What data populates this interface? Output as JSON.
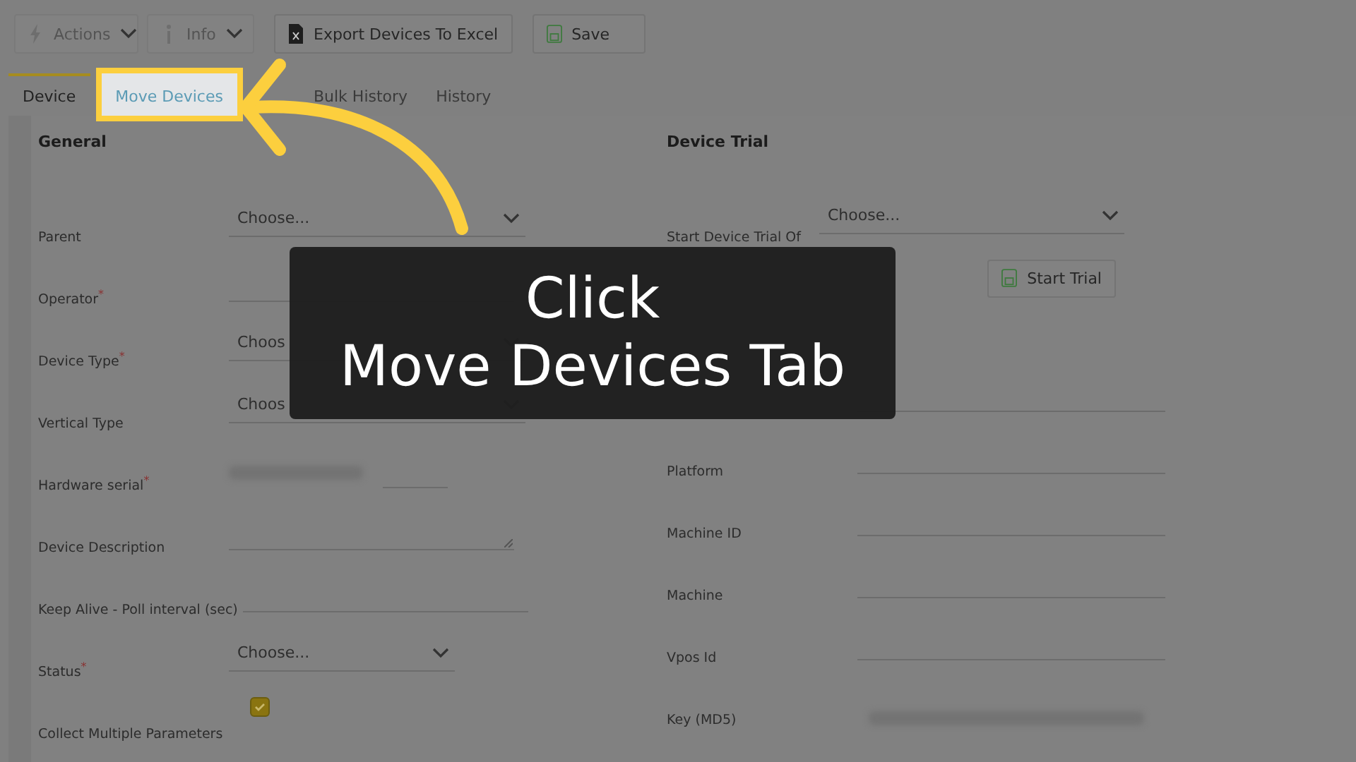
{
  "toolbar": {
    "buttons": [
      {
        "kind": "dropdown",
        "label": "Actions",
        "disabled": true
      },
      {
        "kind": "dropdown",
        "label": "Info",
        "disabled": true
      },
      {
        "kind": "plain",
        "label": "Export Devices To Excel",
        "disabled": false
      },
      {
        "kind": "plain",
        "label": "Save",
        "disabled": false
      }
    ]
  },
  "tabs": [
    {
      "label": "Device",
      "selected": true,
      "highlighted": false
    },
    {
      "label": "Move Devices",
      "selected": false,
      "highlighted": true
    },
    {
      "label": "Bulk History",
      "selected": false,
      "highlighted": false
    },
    {
      "label": "History",
      "selected": false,
      "highlighted": false
    }
  ],
  "general": {
    "title": "General",
    "fields": [
      {
        "kind": "select",
        "label": "Parent",
        "placeholder": "Choose..."
      },
      {
        "kind": "list",
        "label": "Operator$^{*}$"
      },
      {
        "kind": "select",
        "label": "Device Type$^{*}$",
        "placeholder": "Choos"
      },
      {
        "kind": "select",
        "label": "Vertical Type",
        "placeholder": "Choos"
      },
      {
        "kind": "hidden",
        "label": "Hardware serial$^{*}$"
      },
      {
        "kind": "textarea",
        "label": "Device Description"
      },
      {
        "kind": "text",
        "label": "Keep Alive - Poll interval (sec)"
      },
      {
        "kind": "short-select",
        "label": "Status$^{*}$",
        "placeholder": "Choose..."
      },
      {
        "kind": "checkbox",
        "label": "Collect Multiple Parameters",
        "checked": true
      }
    ]
  },
  "device_trial": {
    "title": "Device Trial",
    "label": "Start Device Trial Of",
    "placeholder": "Choose...",
    "button": "Start Trial"
  },
  "hardware": {
    "fields": [
      {
        "kind": "text"
      },
      {
        "kind": "text",
        "label": "Platform"
      },
      {
        "kind": "text",
        "label": "Machine ID"
      },
      {
        "kind": "text",
        "label": "Machine"
      },
      {
        "kind": "text",
        "label": "Vpos Id"
      },
      {
        "kind": "hidden",
        "label": "Key (MD5)"
      }
    ]
  },
  "caption": {
    "lines": [
      "Click",
      "Move Devices Tab"
    ]
  }
}
